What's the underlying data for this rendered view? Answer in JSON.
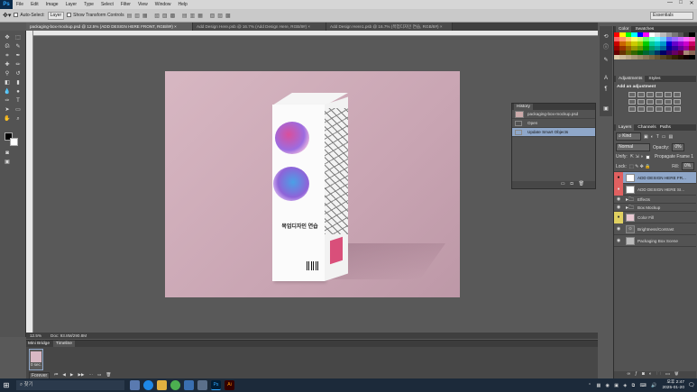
{
  "app": {
    "logo": "Ps",
    "menu": [
      "File",
      "Edit",
      "Image",
      "Layer",
      "Type",
      "Select",
      "Filter",
      "View",
      "Window",
      "Help"
    ],
    "window_controls": [
      "—",
      "□",
      "✕"
    ]
  },
  "options": {
    "tool_icon": "move-tool-icon",
    "auto_select_label": "Auto-Select:",
    "auto_select_value": "Layer",
    "show_transform": "Show Transform Controls",
    "workspace": "Essentials"
  },
  "tabs": [
    "packaging-box-mockup.psd @ 12.5% (ADD DESIGN HERE FRONT, RGB/8#) ×",
    "Add Design Here.psb @ 16.7% (Add Design Here, RGB/8#) ×",
    "Add Design Here1.psb @ 16.7% (목업디자인 연습, RGB/8#) ×"
  ],
  "document": {
    "box_title": "목업디자인 연습"
  },
  "history": {
    "tab": "History",
    "items": [
      {
        "label": "packaging-box-mockup.psd"
      },
      {
        "label": "Open"
      },
      {
        "label": "Update Smart Objects"
      }
    ]
  },
  "swatches": {
    "tabs": [
      "Color",
      "Swatches"
    ]
  },
  "adjustments": {
    "tabs": [
      "Adjustments",
      "Styles"
    ],
    "title": "Add an adjustment"
  },
  "layers": {
    "tabs": [
      "Layers",
      "Channels",
      "Paths"
    ],
    "kind": "Kind",
    "blend": "Normal",
    "opacity_label": "Opacity:",
    "opacity": "0%",
    "unify_label": "Unify:",
    "propagate": "Propagate Frame 1",
    "lock_label": "Lock:",
    "fill_label": "Fill:",
    "fill": "0%",
    "items": [
      {
        "name": "ADD DESIGN HERE FR..."
      },
      {
        "name": "ADD DESIGN HERE SI..."
      },
      {
        "name": "Effects"
      },
      {
        "name": "Box Mockup"
      },
      {
        "name": "Color Fill"
      },
      {
        "name": "Brightness/Contrast"
      },
      {
        "name": "Packaging Box Scene"
      }
    ]
  },
  "status": {
    "zoom": "12.5%",
    "doc": "Doc: 93.8M/290.8M"
  },
  "timeline": {
    "tabs": [
      "Mini Bridge",
      "Timeline"
    ],
    "frame_time": "0 sec.",
    "loop": "Forever"
  },
  "taskbar": {
    "search": "찾기",
    "clock_time": "오후 2:47",
    "clock_date": "2025-01-20"
  }
}
